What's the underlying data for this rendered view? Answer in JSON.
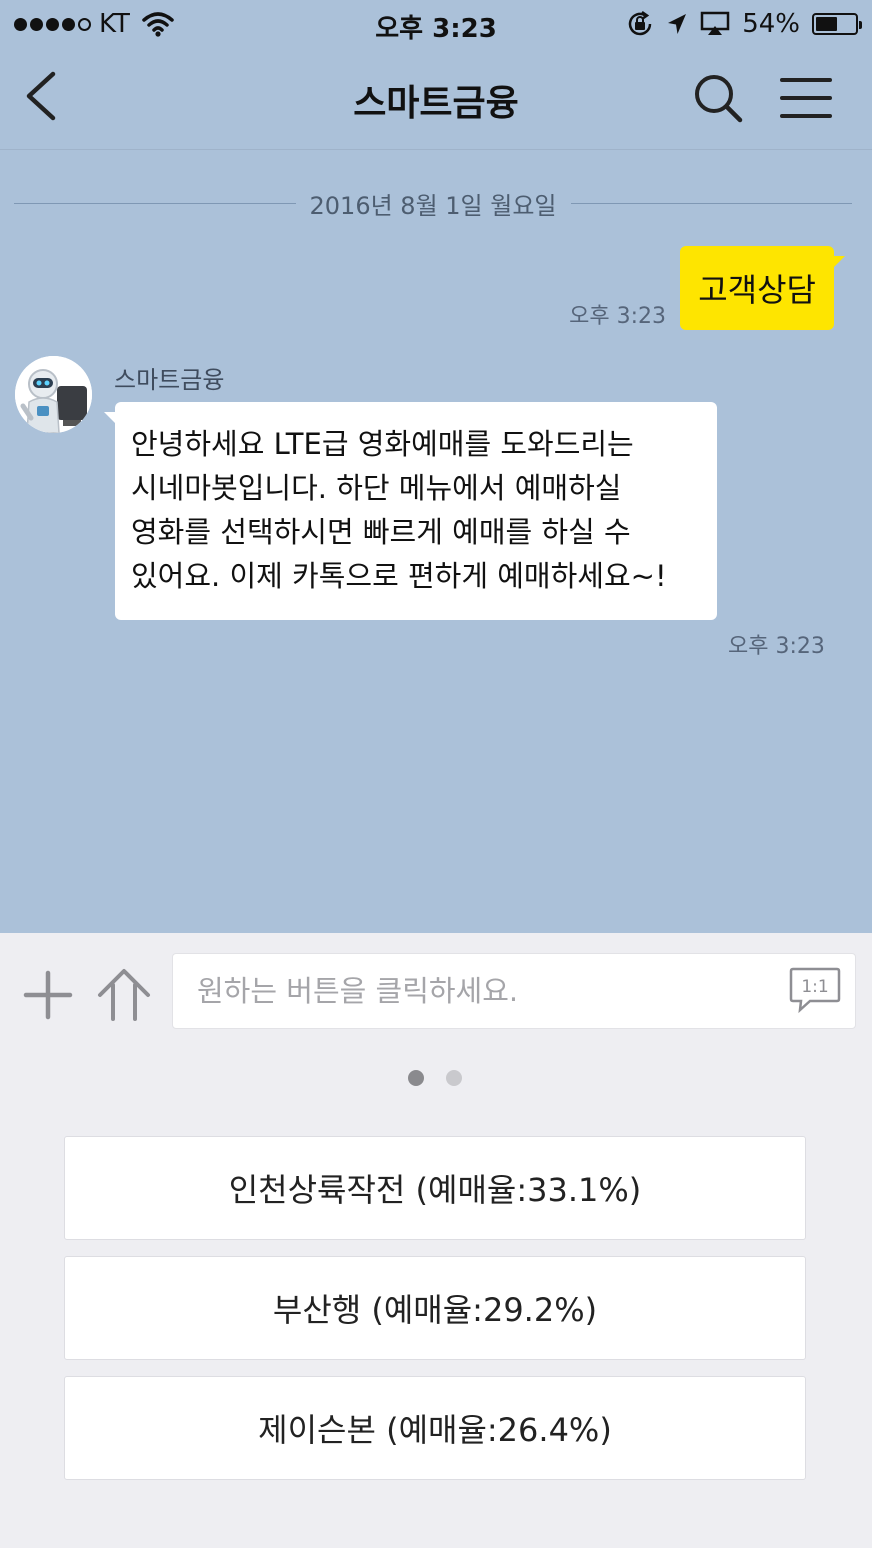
{
  "status_bar": {
    "carrier": "KT",
    "time": "오후 3:23",
    "battery_percent": "54%",
    "battery_level": 0.54,
    "icons": [
      "signal-dots",
      "wifi-icon",
      "rotation-lock-icon",
      "location-arrow-icon",
      "airplay-icon",
      "battery-icon"
    ]
  },
  "nav": {
    "title": "스마트금융",
    "icons": [
      "back-chevron-icon",
      "search-icon",
      "hamburger-menu-icon"
    ]
  },
  "chat": {
    "date_divider": "2016년 8월 1일 월요일",
    "outgoing": {
      "text": "고객상담",
      "time": "오후 3:23"
    },
    "incoming": {
      "sender": "스마트금융",
      "text": "안녕하세요 LTE급 영화예매를 도와드리는 시네마봇입니다. 하단 메뉴에서 예매하실 영화를 선택하시면 빠르게 예매를 하실 수 있어요. 이제 카톡으로 편하게 예매하세요~!",
      "time": "오후 3:23"
    }
  },
  "input": {
    "placeholder": "원하는 버튼을 클릭하세요.",
    "oneone_label": "1:1",
    "icons": [
      "plus-icon",
      "up-arrow-icon",
      "one-to-one-chat-icon"
    ]
  },
  "pager": {
    "count": 2,
    "active": 0
  },
  "quick_replies": [
    {
      "label": "인천상륙작전 (예매율:33.1%)"
    },
    {
      "label": "부산행 (예매율:29.2%)"
    },
    {
      "label": "제이슨본 (예매율:26.4%)"
    }
  ],
  "colors": {
    "chat_background": "#abc1d9",
    "outgoing_bubble": "#fee500",
    "incoming_bubble": "#ffffff",
    "bottom_panel": "#eeeef2"
  }
}
